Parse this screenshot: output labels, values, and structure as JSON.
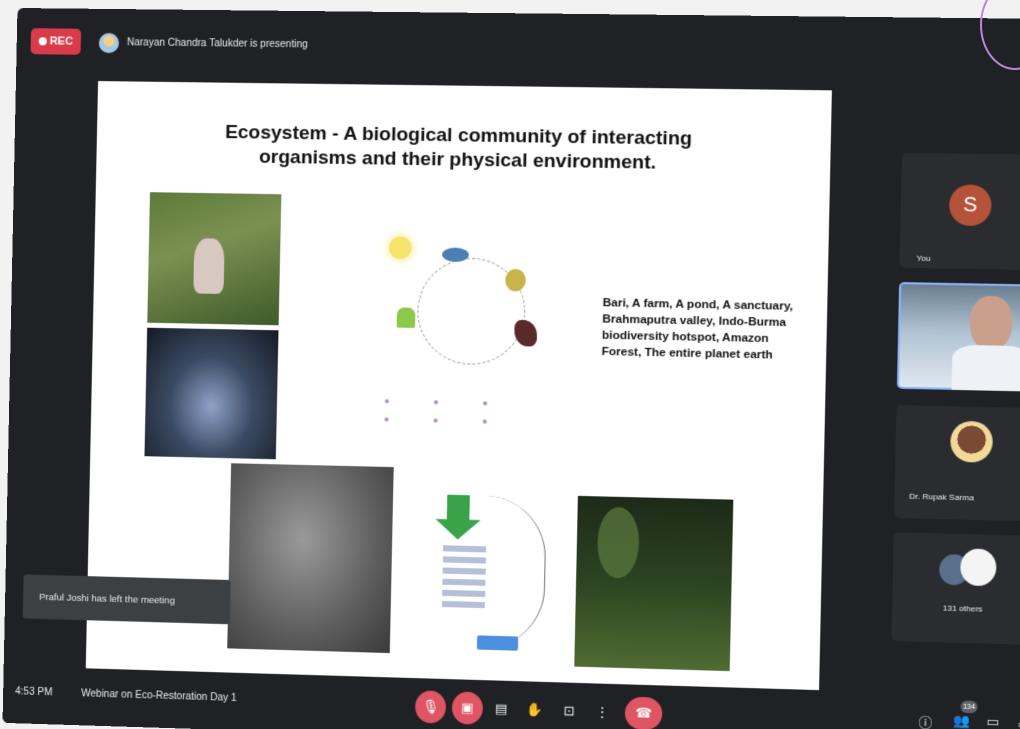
{
  "top_bar": {
    "rec_label": "REC",
    "presenting_text": "Narayan Chandra Talukder is presenting"
  },
  "slide": {
    "title_line1": "Ecosystem - A biological community of interacting",
    "title_line2": "organisms and their physical environment.",
    "examples_text": "Bari, A farm, A pond, A sanctuary, Brahmaputra valley, Indo-Burma biodiversity hotspot, Amazon Forest, The entire planet earth"
  },
  "toast": {
    "message": "Praful Joshi has left the meeting"
  },
  "participants": {
    "you": {
      "initial": "S",
      "label": "You"
    },
    "rupak": {
      "label": "Dr. Rupak Sarma"
    },
    "others": {
      "label": "131 others"
    }
  },
  "bottom_bar": {
    "time": "4:53 PM",
    "meeting_title": "Webinar on Eco-Restoration Day 1",
    "participant_count": "134"
  },
  "colors": {
    "accent_red": "#e05563",
    "rec_red": "#d93b4a",
    "active_speaker_border": "#8ab4f8",
    "bar_bg": "#202124"
  }
}
